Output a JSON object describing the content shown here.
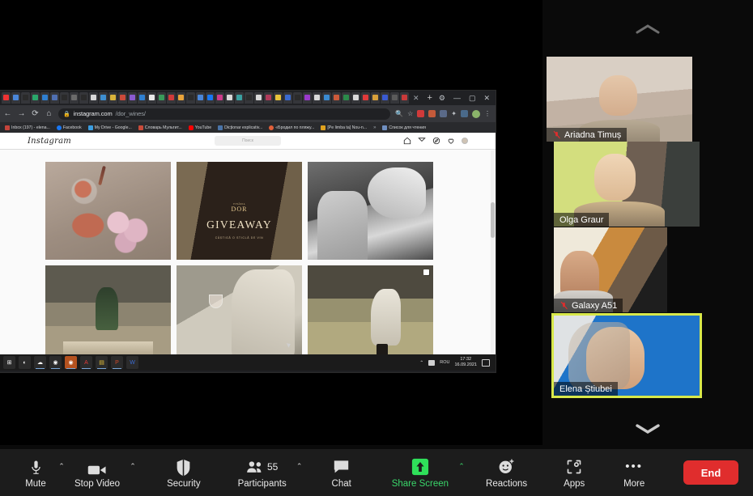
{
  "meeting": {
    "scroll_up_icon": "chevron-up-icon",
    "scroll_down_icon": "chevron-down-icon"
  },
  "participants_strip": [
    {
      "name": "Ariadna Timuș",
      "muted": true,
      "active_speaker": false
    },
    {
      "name": "Olga Graur",
      "muted": false,
      "active_speaker": false
    },
    {
      "name": "Galaxy A51",
      "muted": true,
      "active_speaker": false
    },
    {
      "name": "Elena Știubei",
      "muted": false,
      "active_speaker": true
    }
  ],
  "toolbar": {
    "mute_label": "Mute",
    "mute_icon": "microphone-icon",
    "stop_video_label": "Stop Video",
    "stop_video_icon": "video-camera-icon",
    "security_label": "Security",
    "security_icon": "shield-icon",
    "participants_label": "Participants",
    "participants_icon": "people-icon",
    "participants_count": "55",
    "chat_label": "Chat",
    "chat_icon": "speech-bubble-icon",
    "share_screen_label": "Share Screen",
    "share_screen_icon": "up-arrow-icon",
    "share_screen_active_color": "#3ad66a",
    "reactions_label": "Reactions",
    "reactions_icon": "smiley-plus-icon",
    "apps_label": "Apps",
    "apps_icon": "apps-bracket-icon",
    "more_label": "More",
    "more_icon": "ellipsis-icon",
    "end_label": "End",
    "end_color": "#e02d2d",
    "caret_icon": "chevron-up-icon"
  },
  "shared_screen": {
    "browser": {
      "back_icon": "arrow-left-icon",
      "forward_icon": "arrow-right-icon",
      "reload_icon": "reload-icon",
      "home_icon": "home-icon",
      "lock_icon": "lock-icon",
      "url_domain": "instagram.com",
      "url_path": "/dor_wines/",
      "zoom_icon": "magnifier-icon",
      "bookmark_star_icon": "star-icon",
      "extensions_icon": "puzzle-icon",
      "profile_icon": "avatar-icon",
      "menu_icon": "three-dot-menu-icon",
      "new_tab_icon": "plus-icon",
      "close_tab_icon": "close-icon",
      "window_minimize_icon": "minimize-icon",
      "window_maximize_icon": "maximize-icon",
      "window_close_icon": "close-icon",
      "settings_icon": "gear-icon",
      "bookmarks": [
        {
          "label": "Inbox (197) - elena...",
          "color": "#c5443b"
        },
        {
          "label": "Facebook",
          "color": "#1877f2"
        },
        {
          "label": "My Drive - Google...",
          "color": "#3b9de0"
        },
        {
          "label": "Словарь Мультит...",
          "color": "#c94b3a"
        },
        {
          "label": "YouTube",
          "color": "#ff0000"
        },
        {
          "label": "Dicționar explicativ...",
          "color": "#4a74a8"
        },
        {
          "label": "«Бродил по пляжу...",
          "color": "#e2603a"
        },
        {
          "label": "[Pe limba ta] Nou-n...",
          "color": "#e0a21e"
        }
      ],
      "bookmarks_overflow_icon": "chevron-right-icon",
      "reading_list_label": "Список для чтения",
      "reading_list_icon": "reading-list-icon"
    },
    "instagram": {
      "logo_text": "Instagram",
      "search_placeholder": "Поиск",
      "nav_icons": [
        "home-icon",
        "messenger-icon",
        "compass-explore-icon",
        "heart-icon",
        "profile-avatar-icon"
      ],
      "posts": [
        {
          "alt": "wine-glasses-and-peonies-flatlay",
          "multi": false,
          "overlay": ""
        },
        {
          "alt": "dor-giveaway-promo",
          "multi": false,
          "brand": "DOR",
          "brand_sub": "VINĂRIA",
          "overlay": "GIVEAWAY",
          "overlay_sub": "CÂȘTIGĂ O STICLĂ DE VIN"
        },
        {
          "alt": "black-and-white-couple-in-headscarf",
          "multi": false,
          "overlay": ""
        },
        {
          "alt": "woman-at-rustic-table-with-food",
          "multi": false,
          "overlay": ""
        },
        {
          "alt": "women-with-wine-glass-and-bread",
          "multi": false,
          "overlay": ""
        },
        {
          "alt": "woman-walking-in-field",
          "multi": true,
          "overlay": ""
        }
      ]
    },
    "taskbar": {
      "start_icon": "windows-start-icon",
      "apps": [
        {
          "name": "cortana-search-icon",
          "color": "#2b2b2b",
          "running": false
        },
        {
          "name": "weather-widget-icon",
          "color": "#2b2b2b",
          "running": false
        },
        {
          "name": "chrome-icon",
          "color": "#2b2b2b",
          "running": true
        },
        {
          "name": "chrome-canary-icon",
          "color": "#b5521f",
          "running": true
        },
        {
          "name": "adobe-acrobat-icon",
          "color": "#2b2b2b",
          "running": true
        },
        {
          "name": "file-explorer-icon",
          "color": "#2b2b2b",
          "running": true
        },
        {
          "name": "powerpoint-icon",
          "color": "#2b2b2b",
          "running": true
        },
        {
          "name": "word-icon",
          "color": "#2b2b2b",
          "running": false
        }
      ],
      "tray_caret_icon": "chevron-up-icon",
      "tray_network_icon": "network-icon",
      "language": "ROU",
      "time": "17:32",
      "date": "16.09.2021",
      "action_center_icon": "action-center-icon"
    }
  }
}
